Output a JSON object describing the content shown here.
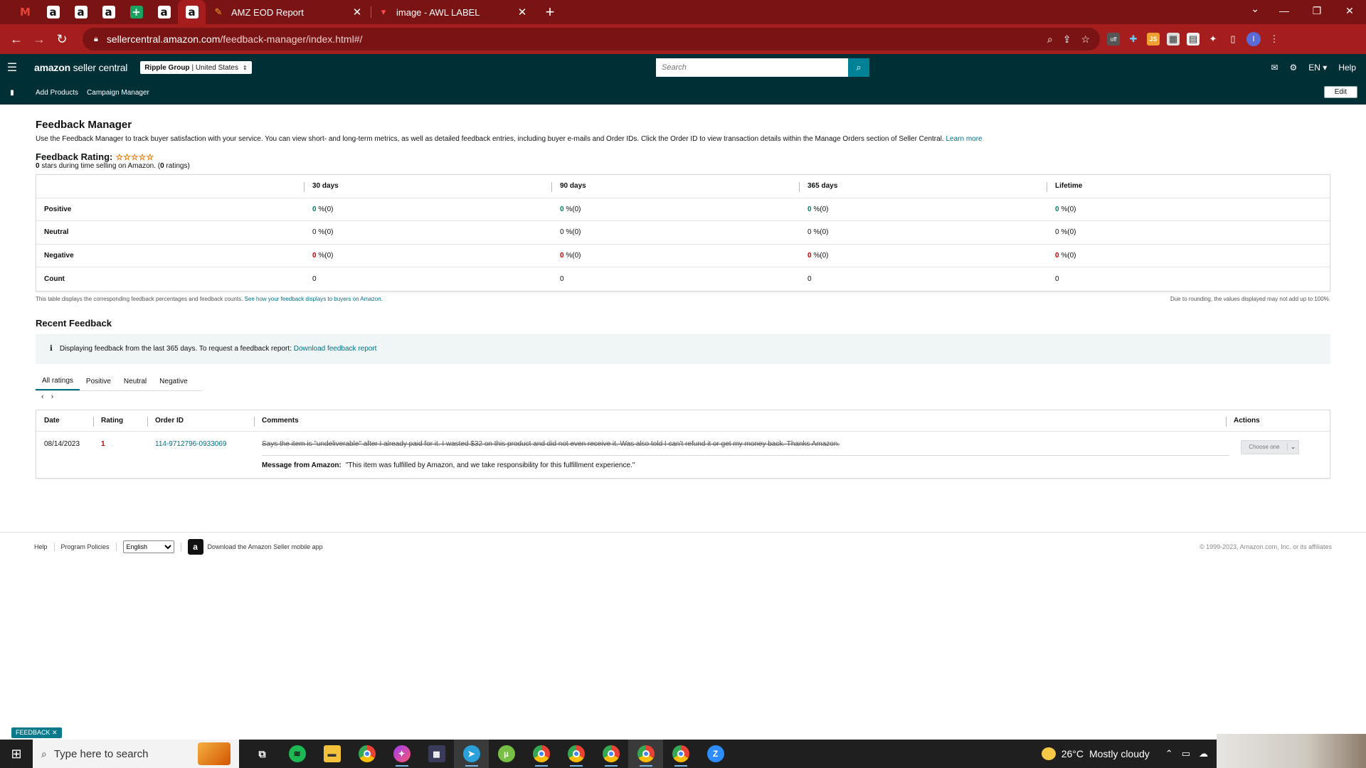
{
  "browser": {
    "tabs": [
      {
        "title": "AMZ EOD Report",
        "icon": "tool-icon"
      },
      {
        "title": "image - AWL LABEL",
        "icon": "label-icon"
      }
    ],
    "url_host": "sellercentral.amazon.com",
    "url_path": "/feedback-manager/index.html#/"
  },
  "header": {
    "logo_bold": "amazon",
    "logo_rest": " seller central",
    "account_name": "Ripple Group",
    "account_region": "| United States",
    "search_placeholder": "Search",
    "lang": "EN",
    "help": "Help"
  },
  "subnav": {
    "links": [
      "Add Products",
      "Campaign Manager"
    ],
    "edit": "Edit"
  },
  "page": {
    "title": "Feedback Manager",
    "intro": "Use the Feedback Manager to track buyer satisfaction with your service. You can view short- and long-term metrics, as well as detailed feedback entries, including buyer e-mails and Order IDs. Click the Order ID to view transaction details within the Manage Orders section of Seller Central.",
    "learn_more": "Learn more",
    "rating_label": "Feedback Rating:",
    "stars": "☆☆☆☆☆",
    "rating_stars_value": "0",
    "rating_sub_mid": " stars during time selling on Amazon. (",
    "rating_count": "0",
    "rating_sub_end": " ratings)"
  },
  "summary": {
    "headers": [
      "30 days",
      "90 days",
      "365 days",
      "Lifetime"
    ],
    "rows": [
      {
        "label": "Positive",
        "values": [
          "0",
          "0",
          "0",
          "0"
        ],
        "suffix": " %(0)"
      },
      {
        "label": "Neutral",
        "values": [
          "0",
          "0",
          "0",
          "0"
        ],
        "suffix": " %(0)"
      },
      {
        "label": "Negative",
        "values": [
          "0",
          "0",
          "0",
          "0"
        ],
        "suffix": " %(0)"
      },
      {
        "label": "Count",
        "values": [
          "0",
          "0",
          "0",
          "0"
        ],
        "suffix": ""
      }
    ],
    "note_left": "This table displays the corresponding feedback percentages and feedback counts.",
    "note_link": "See how your feedback displays to buyers on Amazon.",
    "note_right": "Due to rounding, the values displayed may not add up to 100%."
  },
  "recent": {
    "title": "Recent Feedback",
    "info": "Displaying feedback from the last 365 days. To request a feedback report:",
    "info_link": "Download feedback report",
    "tabs": [
      "All ratings",
      "Positive",
      "Neutral",
      "Negative"
    ],
    "columns": [
      "Date",
      "Rating",
      "Order ID",
      "Comments",
      "Actions"
    ],
    "rows": [
      {
        "date": "08/14/2023",
        "rating": "1",
        "order_id": "114-9712796-0933069",
        "comment": "Says the item is \"undeliverable\" after I already paid for it. I wasted $32 on this product and did not even receive it. Was also told I can't refund it or get my money back. Thanks Amazon.",
        "amazon_label": "Message from Amazon:",
        "amazon_msg": "\"This item was fulfilled by Amazon, and we take responsibility for this fulfillment experience.\"",
        "action": "Choose one"
      }
    ]
  },
  "footer": {
    "help": "Help",
    "policies": "Program Policies",
    "language": "English",
    "app": "Download the Amazon Seller mobile app",
    "copyright": "© 1999-2023, Amazon.com, Inc. or its affiliates"
  },
  "feedback_tag": "FEEDBACK ✕",
  "taskbar": {
    "search": "Type here to search",
    "temp": "26°C",
    "weather": "Mostly cloudy"
  }
}
